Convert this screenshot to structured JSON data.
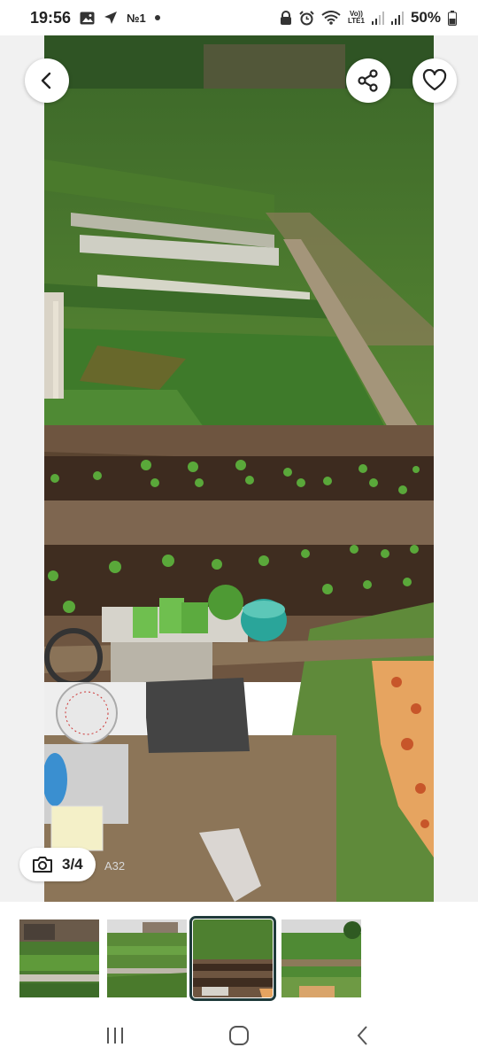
{
  "status_bar": {
    "time": "19:56",
    "carrier_tag": "№1",
    "volte_top": "Vo))",
    "volte_bottom": "LTE1",
    "battery_percent": "50%",
    "icons": [
      "image-icon",
      "location-arrow-icon",
      "dot-icon",
      "alarm-lock-icon",
      "alarm-clock-icon",
      "wifi-icon",
      "signal-icon",
      "signal-icon-2",
      "battery-icon"
    ]
  },
  "viewer": {
    "back_icon": "chevron-left-icon",
    "share_icon": "share-icon",
    "favorite_icon": "heart-icon",
    "counter": "3/4",
    "counter_icon": "camera-icon",
    "photo_caption": "A32"
  },
  "thumbnails": [
    {
      "name": "thumbnail-1",
      "active": false
    },
    {
      "name": "thumbnail-2",
      "active": false
    },
    {
      "name": "thumbnail-3",
      "active": true
    },
    {
      "name": "thumbnail-4",
      "active": false
    }
  ],
  "nav_bar": {
    "icons": [
      "recent-apps-icon",
      "home-icon",
      "back-icon"
    ]
  }
}
